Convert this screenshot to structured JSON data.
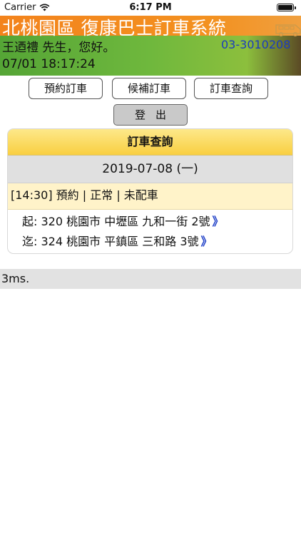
{
  "status_bar": {
    "carrier": "Carrier",
    "time": "6:17 PM",
    "wifi_icon": "wifi-icon",
    "battery_icon": "battery-icon"
  },
  "header": {
    "title": "北桃園區 復康巴士訂車系統",
    "greeting": "王迺禮 先生，您好。",
    "phone": "03-3010208",
    "datetime": "07/01 18:17:24",
    "bus_icon": "bus-icon"
  },
  "nav": {
    "reserve_label": "預約訂車",
    "standby_label": "候補訂車",
    "query_label": "訂車查詢",
    "logout_label": "登出"
  },
  "booking_card": {
    "title": "訂車查詢",
    "date": "2019-07-08 (一)",
    "status": "[14:30] 預約 | 正常 | 未配車",
    "origin": "起: 320 桃園市 中壢區 九和一街 2號",
    "destination": "迄: 324 桃園市 平鎮區 三和路 3號",
    "chevron": "》"
  },
  "footer": {
    "timing": "3ms."
  },
  "colors": {
    "banner_orange": "#f3831c",
    "banner_green": "#6fb83d",
    "phone_blue": "#1a3cbf",
    "card_header_yellow": "#f9cf41",
    "status_row": "#fff3c9"
  }
}
